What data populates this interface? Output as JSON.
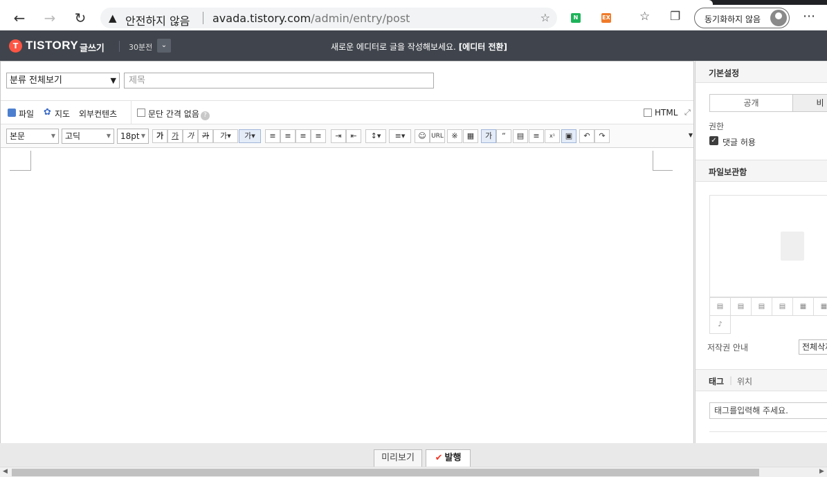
{
  "browser": {
    "warning_text": "안전하지 않음",
    "url_host": "avada.tistory.com",
    "url_path": "/admin/entry/post",
    "ext_n": "N",
    "ext_ex": "EX",
    "sync_label": "동기화하지 않음"
  },
  "header": {
    "logo": "TISTORY",
    "write": "글쓰기",
    "saved_time": "30분전",
    "notice": "새로운 에디터로 글을 작성해보세요.",
    "notice_link": "[에디터 전환]"
  },
  "editor": {
    "category": "분류 전체보기",
    "title_placeholder": "제목",
    "attach": {
      "file": "파일",
      "map": "지도",
      "external": "외부컨텐츠"
    },
    "no_paragraph_gap": "문단 간격 없음",
    "html_label": "HTML",
    "format": {
      "style": "본문",
      "font": "고딕",
      "size": "18pt"
    },
    "url_btn": "URL"
  },
  "sidebar": {
    "basic_settings": "기본설정",
    "visibility_options": [
      "공개",
      "비"
    ],
    "permission_label": "권한",
    "allow_comments": "댓글 허용",
    "file_storage": "파일보관함",
    "copyright_label": "저작권 안내",
    "copyright_value": "전체삭제",
    "tag_tab": "태그",
    "location_tab": "위치",
    "tag_placeholder": "태그를입력해 주세요."
  },
  "footer": {
    "preview": "미리보기",
    "publish": "발행"
  }
}
